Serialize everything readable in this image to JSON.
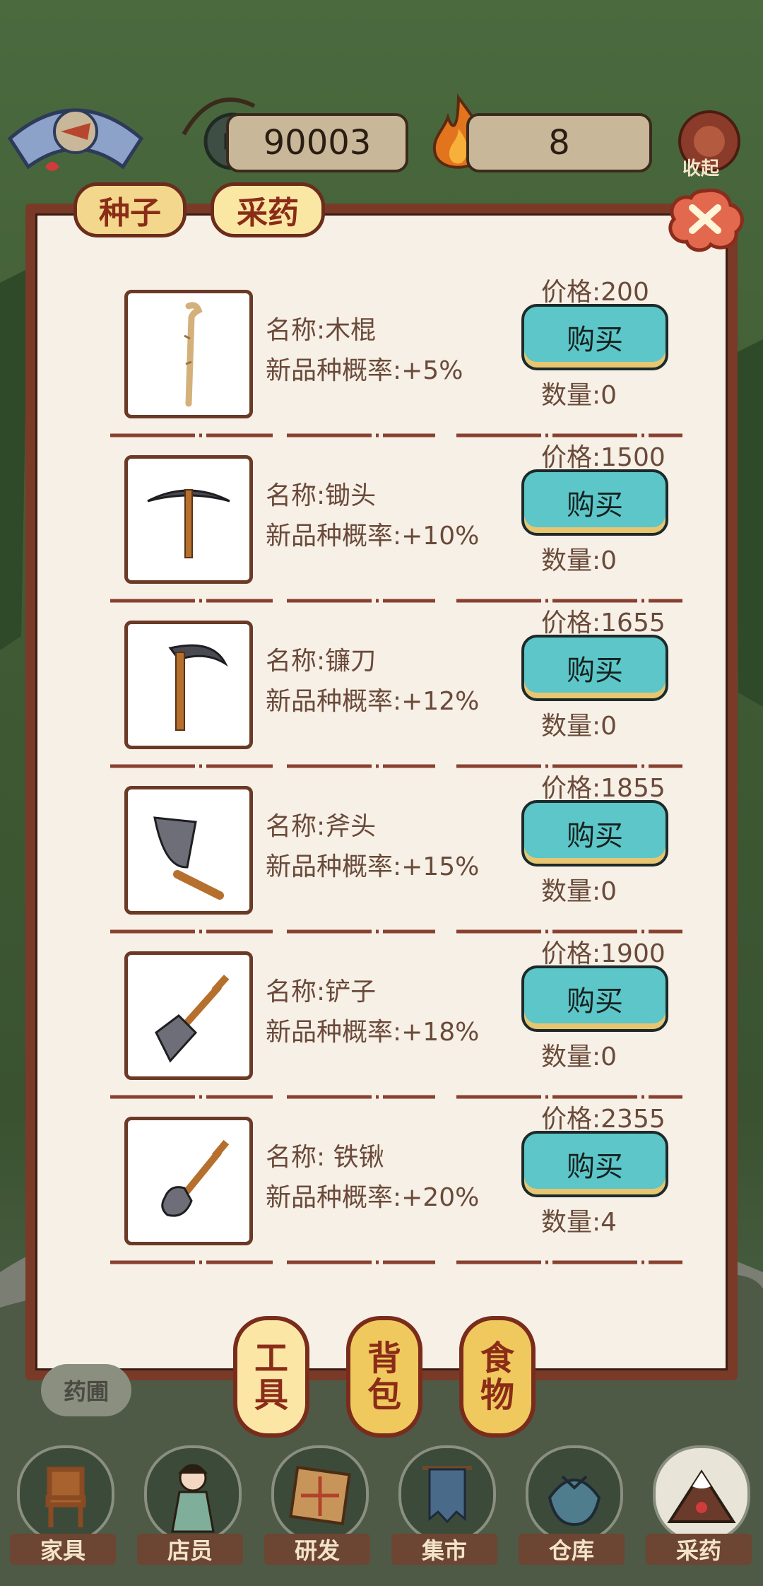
{
  "hud": {
    "coins": "90003",
    "fire": "8",
    "collapse_label": "收起"
  },
  "top_tabs": [
    {
      "label": "种子"
    },
    {
      "label": "采药"
    }
  ],
  "items": [
    {
      "name": "名称:木棍",
      "rate": "新品种概率:+5%",
      "price": "价格:200",
      "buy": "购买",
      "qty": "数量:0",
      "icon": "wooden-stick-icon"
    },
    {
      "name": "名称:锄头",
      "rate": "新品种概率:+10%",
      "price": "价格:1500",
      "buy": "购买",
      "qty": "数量:0",
      "icon": "pickaxe-icon"
    },
    {
      "name": "名称:镰刀",
      "rate": "新品种概率:+12%",
      "price": "价格:1655",
      "buy": "购买",
      "qty": "数量:0",
      "icon": "sickle-icon"
    },
    {
      "name": "名称:斧头",
      "rate": "新品种概率:+15%",
      "price": "价格:1855",
      "buy": "购买",
      "qty": "数量:0",
      "icon": "axe-icon"
    },
    {
      "name": "名称:铲子",
      "rate": "新品种概率:+18%",
      "price": "价格:1900",
      "buy": "购买",
      "qty": "数量:0",
      "icon": "shovel-icon"
    },
    {
      "name": "名称: 铁锹",
      "rate": "新品种概率:+20%",
      "price": "价格:2355",
      "buy": "购买",
      "qty": "数量:4",
      "icon": "spade-icon"
    }
  ],
  "bottom_tabs": [
    {
      "line1": "工",
      "line2": "具"
    },
    {
      "line1": "背",
      "line2": "包"
    },
    {
      "line1": "食",
      "line2": "物"
    }
  ],
  "garden_label": "药圃",
  "nav": [
    {
      "label": "家具",
      "icon": "chair-icon"
    },
    {
      "label": "店员",
      "icon": "clerk-icon"
    },
    {
      "label": "研发",
      "icon": "research-icon"
    },
    {
      "label": "集市",
      "icon": "market-icon"
    },
    {
      "label": "仓库",
      "icon": "warehouse-icon"
    },
    {
      "label": "采药",
      "icon": "mountain-icon"
    }
  ],
  "colors": {
    "panel_border": "#7a3a28",
    "panel_bg": "#f7f0e6",
    "buy_button": "#5cc6c8",
    "tab_gold": "#f3d78c",
    "text_brown": "#6a4a3a"
  }
}
